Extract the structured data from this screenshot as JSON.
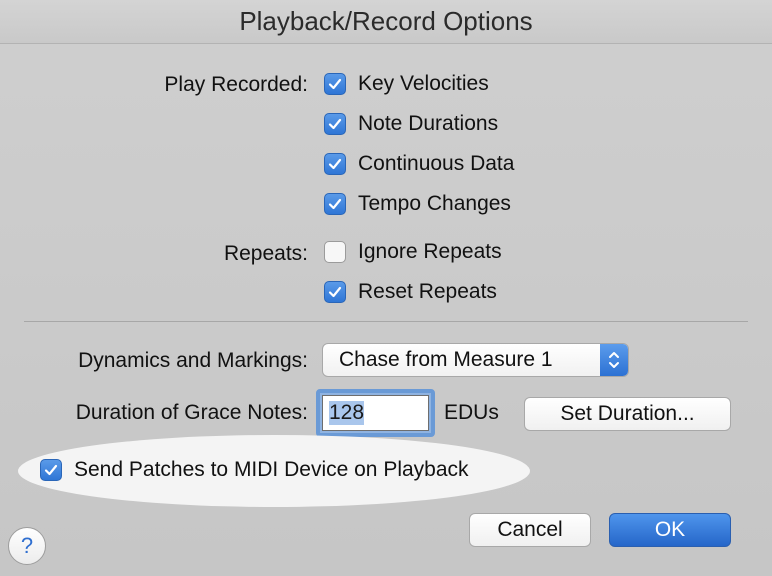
{
  "window": {
    "title": "Playback/Record Options"
  },
  "play_recorded": {
    "label": "Play Recorded:",
    "items": [
      {
        "label": "Key Velocities",
        "checked": true
      },
      {
        "label": "Note Durations",
        "checked": true
      },
      {
        "label": "Continuous Data",
        "checked": true
      },
      {
        "label": "Tempo Changes",
        "checked": true
      }
    ]
  },
  "repeats": {
    "label": "Repeats:",
    "items": [
      {
        "label": "Ignore Repeats",
        "checked": false
      },
      {
        "label": "Reset Repeats",
        "checked": true
      }
    ]
  },
  "dynamics": {
    "label": "Dynamics and Markings:",
    "selected": "Chase from Measure 1"
  },
  "grace_notes": {
    "label": "Duration of Grace Notes:",
    "value": "128",
    "unit": "EDUs",
    "set_button": "Set Duration..."
  },
  "send_patches": {
    "label": "Send Patches to MIDI Device on Playback",
    "checked": true
  },
  "buttons": {
    "cancel": "Cancel",
    "ok": "OK",
    "help": "?"
  },
  "colors": {
    "accent": "#2f76d6",
    "background": "#c8c8c8",
    "highlight": "#f4f4f4"
  }
}
